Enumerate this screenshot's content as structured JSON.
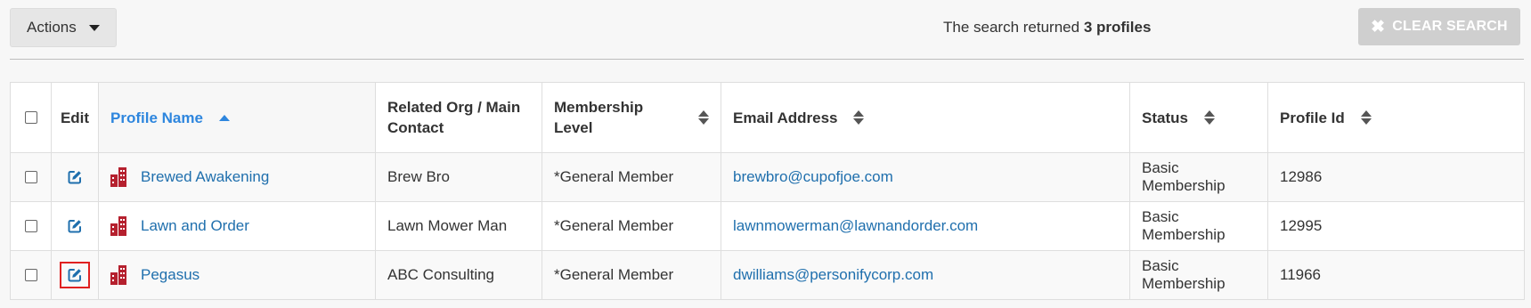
{
  "toolbar": {
    "actions_label": "Actions",
    "search_result_prefix": "The search returned",
    "search_result_count": "3 profiles",
    "clear_search_label": "CLEAR SEARCH"
  },
  "table": {
    "headers": {
      "edit": "Edit",
      "profile_name": "Profile Name",
      "related_org": "Related Org / Main Contact",
      "membership_level": "Membership Level",
      "email": "Email Address",
      "status": "Status",
      "profile_id": "Profile Id"
    },
    "rows": [
      {
        "profile_name": "Brewed Awakening",
        "related_org": "Brew Bro",
        "membership_level": "*General Member",
        "email": "brewbro@cupofjoe.com",
        "status": "Basic Membership",
        "profile_id": "12986"
      },
      {
        "profile_name": "Lawn and Order",
        "related_org": "Lawn Mower Man",
        "membership_level": "*General Member",
        "email": "lawnmowerman@lawnandorder.com",
        "status": "Basic Membership",
        "profile_id": "12995"
      },
      {
        "profile_name": "Pegasus",
        "related_org": "ABC Consulting",
        "membership_level": "*General Member",
        "email": "dwilliams@personifycorp.com",
        "status": "Basic Membership",
        "profile_id": "11966"
      }
    ]
  },
  "colors": {
    "link": "#1f6fad",
    "sorted_header": "#2e86de",
    "org_icon": "#b5202e",
    "focus_outline": "#e02020",
    "clear_button_bg": "#cfcfcf"
  },
  "icons": {
    "actions_caret": "caret-down-icon",
    "clear": "close-icon",
    "edit": "edit-icon",
    "org": "building-icon",
    "sort": "sort-icon"
  }
}
